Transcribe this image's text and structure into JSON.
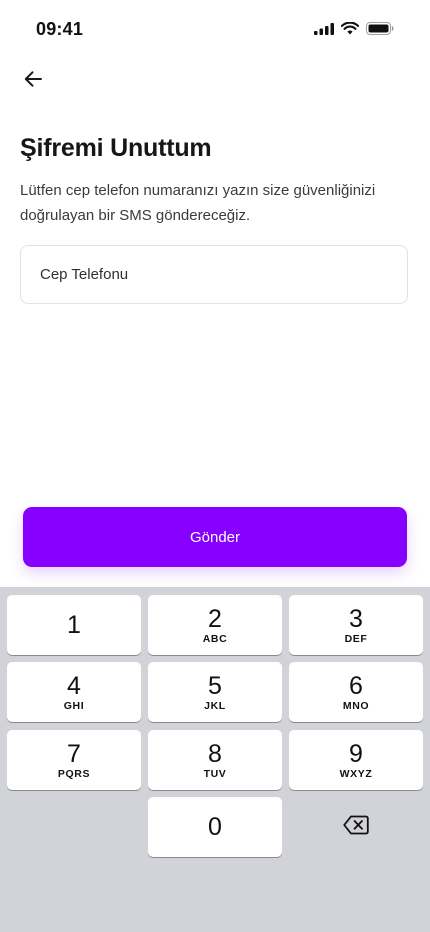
{
  "status_bar": {
    "time": "09:41",
    "icons": [
      "cellular-signal-icon",
      "wifi-icon",
      "battery-icon"
    ]
  },
  "header": {
    "back_icon": "arrow-left-icon"
  },
  "content": {
    "title": "Şifremi Unuttum",
    "description": "Lütfen cep telefon numaranızı yazın size güvenliğinizi doğrulayan bir SMS göndereceğiz.",
    "phone_input": {
      "placeholder": "Cep Telefonu",
      "value": ""
    }
  },
  "actions": {
    "send_label": "Gönder"
  },
  "keypad": {
    "keys": [
      {
        "digit": "1",
        "letters": ""
      },
      {
        "digit": "2",
        "letters": "ABC"
      },
      {
        "digit": "3",
        "letters": "DEF"
      },
      {
        "digit": "4",
        "letters": "GHI"
      },
      {
        "digit": "5",
        "letters": "JKL"
      },
      {
        "digit": "6",
        "letters": "MNO"
      },
      {
        "digit": "7",
        "letters": "PQRS"
      },
      {
        "digit": "8",
        "letters": "TUV"
      },
      {
        "digit": "9",
        "letters": "WXYZ"
      },
      {
        "digit": "0",
        "letters": ""
      }
    ],
    "backspace_icon": "backspace-icon"
  },
  "colors": {
    "accent": "#8700ff",
    "keyboard_background": "#d1d3d9",
    "key_background": "#ffffff",
    "text_primary": "#16161a"
  }
}
